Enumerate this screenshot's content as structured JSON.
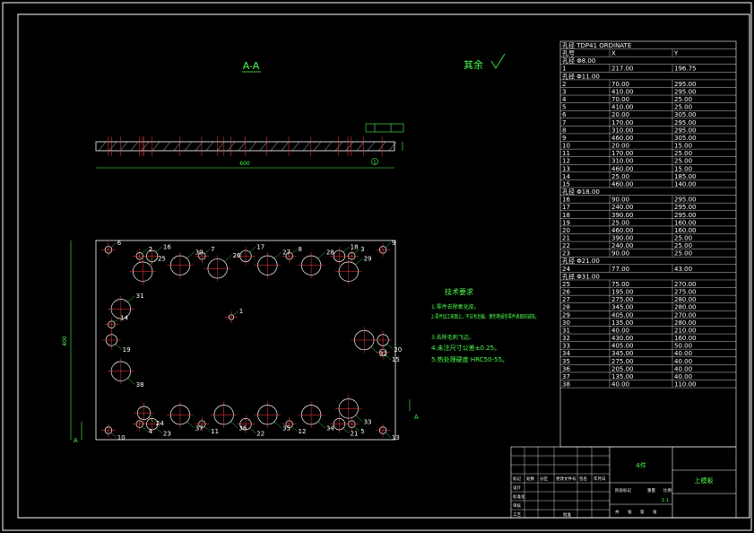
{
  "drawing": {
    "section_title": "A-A",
    "surface_finish_note": "其余",
    "dimension_width": "600",
    "dimension_height": "400",
    "section_marker": "A",
    "callout_one": "1"
  },
  "holes": [
    {
      "id": "1"
    },
    {
      "id": "2"
    },
    {
      "id": "3"
    },
    {
      "id": "4"
    },
    {
      "id": "5"
    },
    {
      "id": "6"
    },
    {
      "id": "7"
    },
    {
      "id": "8"
    },
    {
      "id": "9"
    },
    {
      "id": "10"
    },
    {
      "id": "11"
    },
    {
      "id": "12"
    },
    {
      "id": "13"
    },
    {
      "id": "14"
    },
    {
      "id": "15"
    },
    {
      "id": "16"
    },
    {
      "id": "17"
    },
    {
      "id": "18"
    },
    {
      "id": "19"
    },
    {
      "id": "20"
    },
    {
      "id": "21"
    },
    {
      "id": "22"
    },
    {
      "id": "23"
    },
    {
      "id": "24"
    },
    {
      "id": "25"
    },
    {
      "id": "26"
    },
    {
      "id": "27"
    },
    {
      "id": "28"
    },
    {
      "id": "29"
    },
    {
      "id": "30"
    },
    {
      "id": "31"
    },
    {
      "id": "32"
    },
    {
      "id": "33"
    },
    {
      "id": "34"
    },
    {
      "id": "35"
    },
    {
      "id": "36"
    },
    {
      "id": "37"
    },
    {
      "id": "38"
    }
  ],
  "requirements": {
    "title": "技术要求",
    "items": [
      "1.零件去除氧化皮。",
      "2.零件加工表面上，不应有划痕、擦伤等损伤零件表面的缺陷。",
      "3.去除毛刺飞边。",
      "4.未注尺寸公差±0.25。",
      "5.热处理硬度 HRC50-55。"
    ]
  },
  "ordinate_table": {
    "title": "TDP41 ORDINATE",
    "headers": [
      "孔号",
      "X",
      "Y"
    ],
    "groups": [
      {
        "label": "孔径 Φ8.00",
        "rows": [
          [
            "1",
            "217.00",
            "196.75"
          ]
        ]
      },
      {
        "label": "孔径 Φ11.00",
        "rows": [
          [
            "2",
            "70.00",
            "295.00"
          ],
          [
            "3",
            "410.00",
            "295.00"
          ],
          [
            "4",
            "70.00",
            "25.00"
          ],
          [
            "5",
            "410.00",
            "25.00"
          ],
          [
            "6",
            "20.00",
            "305.00"
          ],
          [
            "7",
            "170.00",
            "295.00"
          ],
          [
            "8",
            "310.00",
            "295.00"
          ],
          [
            "9",
            "460.00",
            "305.00"
          ],
          [
            "10",
            "20.00",
            "15.00"
          ],
          [
            "11",
            "170.00",
            "25.00"
          ],
          [
            "12",
            "310.00",
            "25.00"
          ],
          [
            "13",
            "460.00",
            "15.00"
          ],
          [
            "14",
            "25.00",
            "185.00"
          ],
          [
            "15",
            "460.00",
            "140.00"
          ]
        ]
      },
      {
        "label": "孔径 Φ18.00",
        "rows": [
          [
            "16",
            "90.00",
            "295.00"
          ],
          [
            "17",
            "240.00",
            "295.00"
          ],
          [
            "18",
            "390.00",
            "295.00"
          ],
          [
            "19",
            "25.00",
            "160.00"
          ],
          [
            "20",
            "460.00",
            "160.00"
          ],
          [
            "21",
            "390.00",
            "25.00"
          ],
          [
            "22",
            "240.00",
            "25.00"
          ],
          [
            "23",
            "90.00",
            "25.00"
          ]
        ]
      },
      {
        "label": "孔径 Φ21.00",
        "rows": [
          [
            "24",
            "77.00",
            "43.00"
          ]
        ]
      },
      {
        "label": "孔径 Φ31.00",
        "rows": [
          [
            "25",
            "75.00",
            "270.00"
          ],
          [
            "26",
            "195.00",
            "275.00"
          ],
          [
            "27",
            "275.00",
            "280.00"
          ],
          [
            "28",
            "345.00",
            "280.00"
          ],
          [
            "29",
            "405.00",
            "270.00"
          ],
          [
            "30",
            "135.00",
            "280.00"
          ],
          [
            "31",
            "40.00",
            "210.00"
          ],
          [
            "32",
            "430.00",
            "160.00"
          ],
          [
            "33",
            "405.00",
            "50.00"
          ],
          [
            "34",
            "345.00",
            "40.00"
          ],
          [
            "35",
            "275.00",
            "40.00"
          ],
          [
            "36",
            "205.00",
            "40.00"
          ],
          [
            "37",
            "135.00",
            "40.00"
          ],
          [
            "38",
            "40.00",
            "110.00"
          ]
        ]
      }
    ]
  },
  "title_block": {
    "part_name": "4件",
    "drawing_name": "上模板",
    "labels": [
      "标记",
      "处数",
      "分区",
      "更改文件号",
      "签名",
      "年月日",
      "设计",
      "标准化",
      "阶段标记",
      "重量",
      "比例",
      "审核",
      "工艺",
      "批准",
      "共",
      "张",
      "第",
      "张"
    ],
    "scale": "1:1"
  },
  "colors": {
    "background": "#000000",
    "outline": "#ffffff",
    "hole": "#ff3b3b",
    "center_line": "#ff3b3b",
    "dimension": "#4cff4c",
    "table_text": "#ffffff",
    "annotation": "#4cff4c"
  }
}
